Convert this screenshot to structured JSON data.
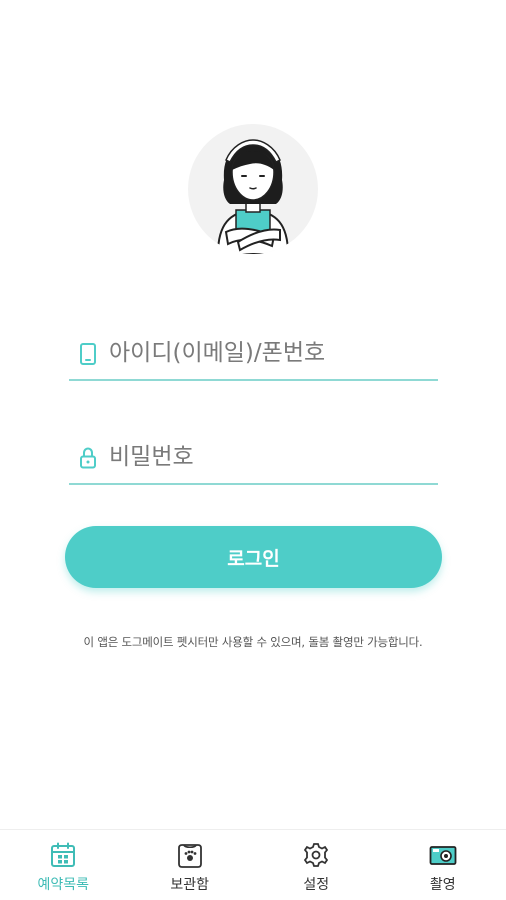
{
  "login": {
    "id_placeholder": "아이디(이메일)/폰번호",
    "password_placeholder": "비밀번호",
    "button_label": "로그인",
    "notice": "이 앱은 도그메이트 펫시터만 사용할 수 있으며, 돌봄 촬영만 가능합니다."
  },
  "tabs": [
    {
      "label": "예약목록",
      "icon": "calendar-icon",
      "active": true
    },
    {
      "label": "보관함",
      "icon": "storage-box-icon",
      "active": false
    },
    {
      "label": "설정",
      "icon": "gear-icon",
      "active": false
    },
    {
      "label": "촬영",
      "icon": "camera-icon",
      "active": false
    }
  ],
  "colors": {
    "accent": "#4ecdc8",
    "underline": "#8fd9d4",
    "active_tab": "#3fbcb6"
  }
}
